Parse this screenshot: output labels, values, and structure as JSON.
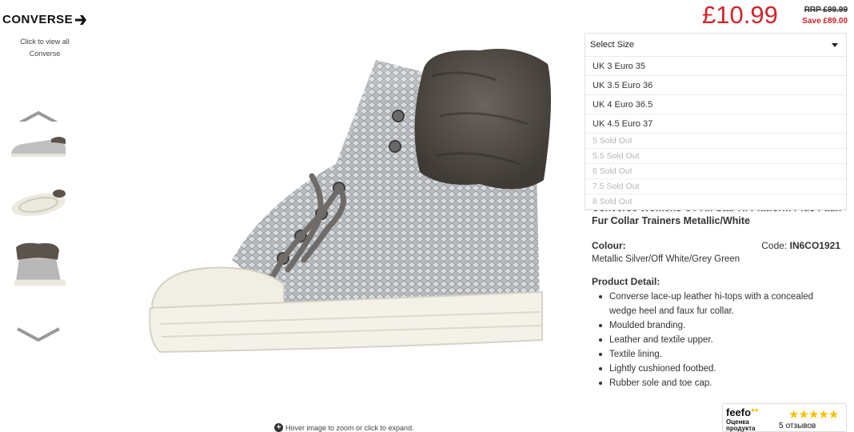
{
  "brand": {
    "logo_text": "CONVERSE",
    "logo_icon": "chevron-right-icon"
  },
  "sidebar": {
    "view_all": "Click to view all Converse",
    "up_icon": "chevron-up-icon",
    "down_icon": "chevron-down-icon",
    "thumbnails": [
      "side view",
      "sole view",
      "back fur view"
    ]
  },
  "price": {
    "current": "£10.99",
    "rrp": "RRP £99.99",
    "save": "Save £89.00",
    "accent_color": "#d2232a"
  },
  "size_select": {
    "selected": "Select Size",
    "options": [
      {
        "label": "UK 3 Euro 35",
        "sold_out": false
      },
      {
        "label": "UK 3.5 Euro 36",
        "sold_out": false
      },
      {
        "label": "UK 4 Euro 36.5",
        "sold_out": false
      },
      {
        "label": "UK 4.5 Euro 37",
        "sold_out": false
      },
      {
        "label": "5 Sold Out",
        "sold_out": true
      },
      {
        "label": "5.5 Sold Out",
        "sold_out": true
      },
      {
        "label": "6 Sold Out",
        "sold_out": true
      },
      {
        "label": "7.5 Sold Out",
        "sold_out": true
      },
      {
        "label": "8 Sold Out",
        "sold_out": true
      }
    ]
  },
  "product": {
    "title": "Converse Womens CT All Star Hi Platform Plus Faux Fur Collar Trainers Metallic/White",
    "colour_label": "Colour:",
    "colour_value": "Metallic Silver/Off White/Grey Green",
    "code_label": "Code:",
    "code_value": "IN6CO1921",
    "detail_label": "Product Detail:",
    "details": [
      "Converse lace-up leather hi-tops with a concealed wedge heel and faux fur collar.",
      "Moulded branding.",
      "Leather and textile upper.",
      "Textile lining.",
      "Lightly cushioned footbed.",
      "Rubber sole and toe cap."
    ]
  },
  "main_image": {
    "hint": "Hover image to zoom or click to expand.",
    "hint_icon": "plus-circle-icon"
  },
  "feefo": {
    "brand": "feefo",
    "rating_text_1": "Оценка",
    "rating_text_2": "продукта",
    "stars": "★★★★★",
    "review_count": "5",
    "review_word": "отзывов",
    "star_color": "#f6c000"
  }
}
